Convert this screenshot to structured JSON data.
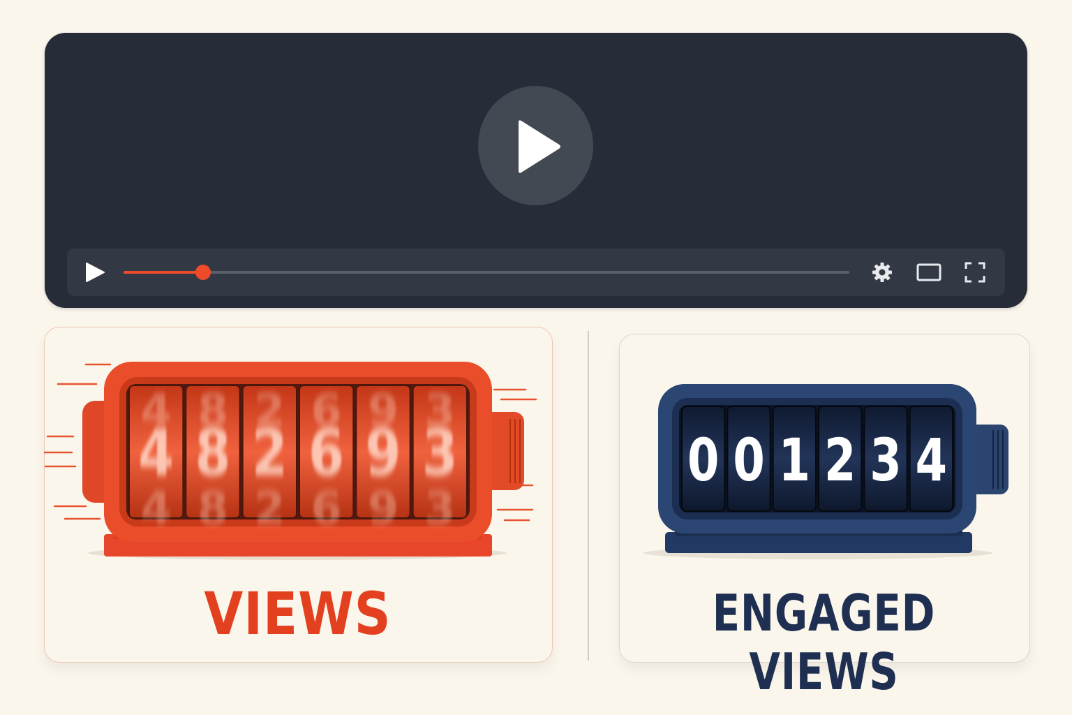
{
  "player": {
    "progress_fraction": 0.11,
    "colors": {
      "background": "#262d38",
      "accent": "#ef4b2b"
    },
    "icons": [
      "play-icon",
      "settings-gear-icon",
      "theater-mode-icon",
      "fullscreen-icon"
    ]
  },
  "views_card": {
    "label": "VIEWS",
    "digits": [
      "4",
      "8",
      "2",
      "6",
      "9",
      "3"
    ],
    "color": "#e2401f"
  },
  "engaged_card": {
    "label": "ENGAGED VIEWS",
    "digits": [
      "0",
      "0",
      "1",
      "2",
      "3",
      "4"
    ],
    "color": "#1f2f52"
  }
}
